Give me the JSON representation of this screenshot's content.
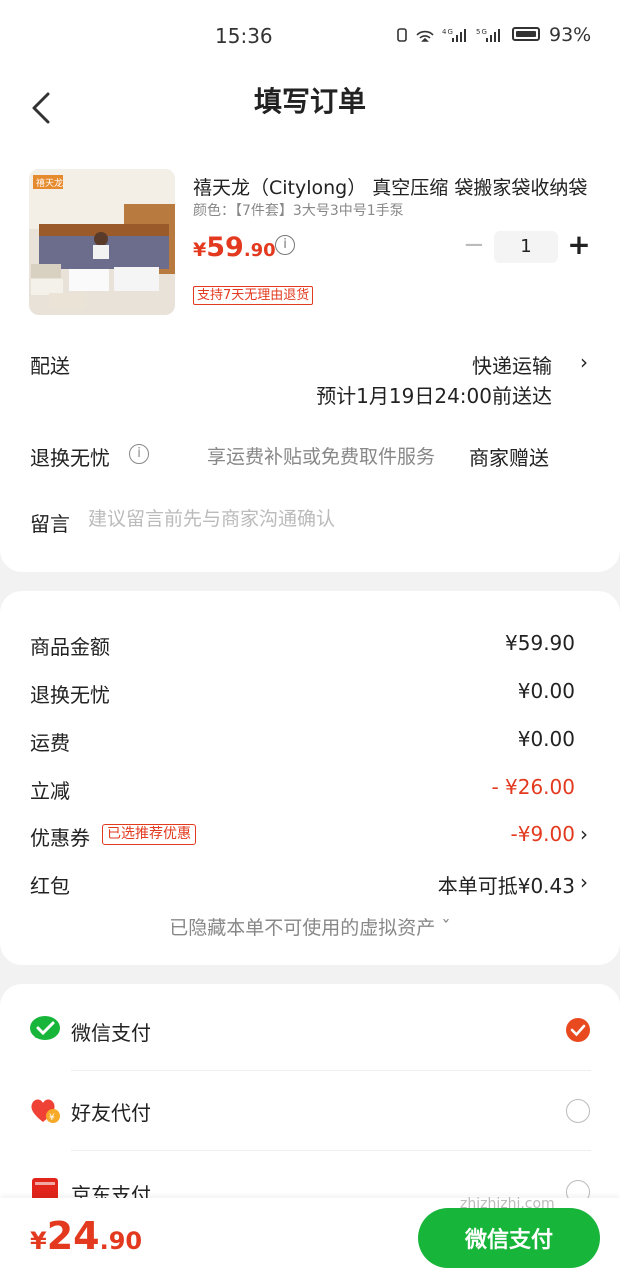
{
  "status_bar": {
    "time": "15:36",
    "signal_text": "4G 5G",
    "battery_pct": "93%"
  },
  "nav": {
    "title": "填写订单"
  },
  "product": {
    "name": "禧天龙（Citylong） 真空压缩 袋搬家袋收纳袋",
    "spec": "颜色：【7件套】3大号3中号1手泵",
    "price_currency": "¥",
    "price_int": "59",
    "price_dec": ".90",
    "quantity": "1",
    "return_badge": "支持7天无理由退货",
    "thumb_logo": "禧天龙"
  },
  "shipping": {
    "label": "配送",
    "method": "快递运输",
    "eta": "预计1月19日24:00前送达"
  },
  "worry_free": {
    "label": "退换无忧",
    "desc": "享运费补贴或免费取件服务",
    "value": "商家赠送"
  },
  "message": {
    "label": "留言",
    "placeholder": "建议留言前先与商家沟通确认"
  },
  "summary": {
    "goods_label": "商品金额",
    "goods_value": "¥59.90",
    "worry_label": "退换无忧",
    "worry_value": "¥0.00",
    "freight_label": "运费",
    "freight_value": "¥0.00",
    "discount_label": "立减",
    "discount_value": "- ¥26.00",
    "coupon_label": "优惠券",
    "coupon_badge": "已选推荐优惠",
    "coupon_value": "-¥9.00",
    "redpacket_label": "红包",
    "redpacket_value": "本单可抵¥0.43",
    "hidden_note": "已隐藏本单不可使用的虚拟资产 ˇ"
  },
  "payment": {
    "wechat": "微信支付",
    "friend": "好友代付",
    "jd": "京东支付"
  },
  "bottom": {
    "total_currency": "¥",
    "total_int": "24",
    "total_dec": ".90",
    "pay_button": "微信支付"
  },
  "watermark": "zhizhizhi.com",
  "colors": {
    "accent_red": "#e33a1f",
    "wechat_green": "#18b53b",
    "check_orange": "#e8491f"
  }
}
